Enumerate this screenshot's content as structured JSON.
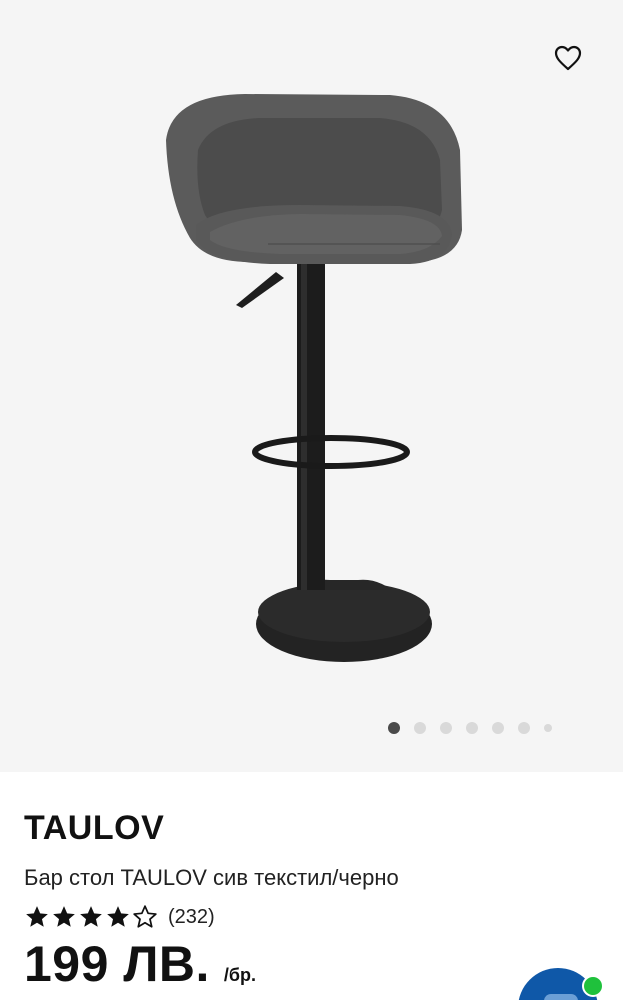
{
  "product": {
    "brand": "TAULOV",
    "description": "Бар стол TAULOV сив текстил/черно",
    "rating": {
      "stars": 4,
      "max_stars": 5,
      "count_text": "(232)"
    },
    "price": "199 ЛВ.",
    "unit": "/бр."
  },
  "gallery": {
    "image_count": 7,
    "active_index": 0,
    "icons": {
      "favorite": "heart-outline-icon",
      "chat": "chat-icon"
    }
  },
  "colors": {
    "gallery_bg": "#f5f5f5",
    "chat_button": "#0f58a8",
    "online_indicator": "#1fc13c"
  }
}
